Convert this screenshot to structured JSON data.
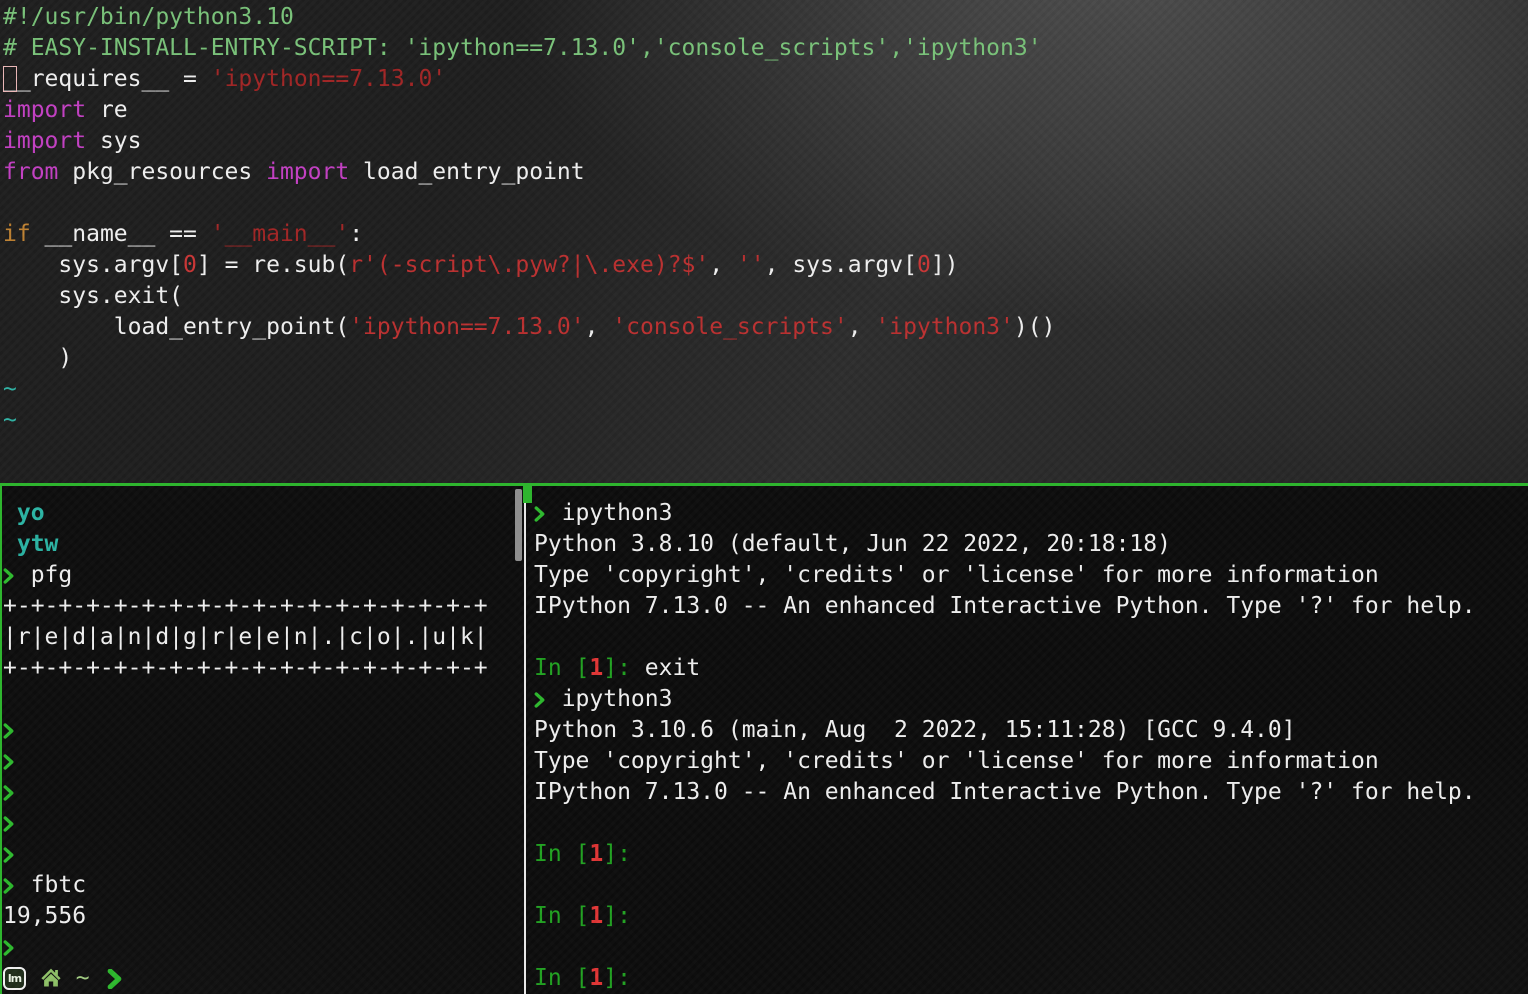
{
  "colors": {
    "accent_green": "#2eb52e",
    "prompt_green": "#2db92d",
    "comment_green": "#7ac47a",
    "keyword_magenta": "#c540c5",
    "conditional_orange": "#c08232",
    "string_red": "#bc3030",
    "string_dim_red": "#a22525",
    "number_red": "#cb3636",
    "ipython_in_green": "#21a321",
    "ipython_number_red": "#e23535",
    "teal": "#2fb3a5",
    "status_green": "#a4cf84",
    "foreground": "#f1f1f1",
    "divider_white": "#e8e8e8"
  },
  "editor_pane": {
    "lines": [
      [
        {
          "t": "#!/usr/bin/python3.10",
          "s": "c"
        }
      ],
      [
        {
          "t": "# EASY-INSTALL-ENTRY-SCRIPT: 'ipython==7.13.0','console_scripts','ipython3'",
          "s": "c"
        }
      ],
      [
        {
          "t": "_",
          "s": "cur"
        },
        {
          "t": "_requires__ = ",
          "s": "w"
        },
        {
          "t": "'ipython==7.13.0'",
          "s": "strd"
        }
      ],
      [
        {
          "t": "import",
          "s": "kw"
        },
        {
          "t": " re",
          "s": "w"
        }
      ],
      [
        {
          "t": "import",
          "s": "kw"
        },
        {
          "t": " sys",
          "s": "w"
        }
      ],
      [
        {
          "t": "from",
          "s": "kw"
        },
        {
          "t": " pkg_resources ",
          "s": "w"
        },
        {
          "t": "import",
          "s": "kw"
        },
        {
          "t": " load_entry_point",
          "s": "w"
        }
      ],
      [],
      [
        {
          "t": "if",
          "s": "cond"
        },
        {
          "t": " __name__ == ",
          "s": "w"
        },
        {
          "t": "'__main__'",
          "s": "strd"
        },
        {
          "t": ":",
          "s": "w"
        }
      ],
      [
        {
          "t": "    sys.argv[",
          "s": "w"
        },
        {
          "t": "0",
          "s": "num"
        },
        {
          "t": "] = re.sub(",
          "s": "w"
        },
        {
          "t": "r'(-script\\.pyw?|\\.exe)?$'",
          "s": "str"
        },
        {
          "t": ", ",
          "s": "w"
        },
        {
          "t": "''",
          "s": "str"
        },
        {
          "t": ", sys.argv[",
          "s": "w"
        },
        {
          "t": "0",
          "s": "num"
        },
        {
          "t": "])",
          "s": "w"
        }
      ],
      [
        {
          "t": "    sys.exit(",
          "s": "w"
        }
      ],
      [
        {
          "t": "        load_entry_point(",
          "s": "w"
        },
        {
          "t": "'ipython==7.13.0'",
          "s": "str"
        },
        {
          "t": ", ",
          "s": "w"
        },
        {
          "t": "'console_scripts'",
          "s": "str"
        },
        {
          "t": ", ",
          "s": "w"
        },
        {
          "t": "'ipython3'",
          "s": "str"
        },
        {
          "t": ")()",
          "s": "w"
        }
      ],
      [
        {
          "t": "    )",
          "s": "w"
        }
      ],
      [
        {
          "t": "~",
          "s": "tilde"
        }
      ],
      [
        {
          "t": "~",
          "s": "tilde"
        }
      ]
    ]
  },
  "left_pane": {
    "lines": [
      [
        {
          "t": " yo",
          "s": "tealb"
        }
      ],
      [
        {
          "t": " ytw",
          "s": "tealb"
        }
      ],
      [
        {
          "i": "arrow"
        },
        {
          "t": " pfg",
          "s": "w"
        }
      ],
      [
        {
          "t": "+-+-+-+-+-+-+-+-+-+-+-+-+-+-+-+-+-+",
          "s": "w"
        }
      ],
      [
        {
          "t": "|r|e|d|a|n|d|g|r|e|e|n|.|c|o|.|u|k|",
          "s": "w"
        }
      ],
      [
        {
          "t": "+-+-+-+-+-+-+-+-+-+-+-+-+-+-+-+-+-+",
          "s": "w"
        }
      ],
      [],
      [
        {
          "i": "arrow"
        }
      ],
      [
        {
          "i": "arrow"
        }
      ],
      [
        {
          "i": "arrow"
        }
      ],
      [
        {
          "i": "arrow"
        }
      ],
      [
        {
          "i": "arrow"
        }
      ],
      [
        {
          "i": "arrow"
        },
        {
          "t": " fbtc",
          "s": "w"
        }
      ],
      [
        {
          "t": "19,556",
          "s": "w"
        }
      ],
      [
        {
          "i": "arrow"
        }
      ],
      [
        {
          "i": "mint"
        },
        {
          "t": " ",
          "s": "w"
        },
        {
          "i": "home"
        },
        {
          "t": " ",
          "s": "w"
        },
        {
          "t": "~",
          "s": "lg"
        },
        {
          "t": " ",
          "s": "w"
        },
        {
          "i": "arrowbig"
        }
      ]
    ]
  },
  "right_pane": {
    "lines": [
      [
        {
          "i": "arrow"
        },
        {
          "t": " ipython3",
          "s": "w"
        }
      ],
      [
        {
          "t": "Python 3.8.10 (default, Jun 22 2022, 20:18:18)",
          "s": "w"
        }
      ],
      [
        {
          "t": "Type 'copyright', 'credits' or 'license' for more information",
          "s": "w"
        }
      ],
      [
        {
          "t": "IPython 7.13.0 -- An enhanced Interactive Python. Type '?' for help.",
          "s": "w"
        }
      ],
      [],
      [
        {
          "t": "In [",
          "s": "ing"
        },
        {
          "t": "1",
          "s": "inr"
        },
        {
          "t": "]: ",
          "s": "ing"
        },
        {
          "t": "exit",
          "s": "w"
        }
      ],
      [
        {
          "i": "arrow"
        },
        {
          "t": " ipython3",
          "s": "w"
        }
      ],
      [
        {
          "t": "Python 3.10.6 (main, Aug  2 2022, 15:11:28) [GCC 9.4.0]",
          "s": "w"
        }
      ],
      [
        {
          "t": "Type 'copyright', 'credits' or 'license' for more information",
          "s": "w"
        }
      ],
      [
        {
          "t": "IPython 7.13.0 -- An enhanced Interactive Python. Type '?' for help.",
          "s": "w"
        }
      ],
      [],
      [
        {
          "t": "In [",
          "s": "ing"
        },
        {
          "t": "1",
          "s": "inr"
        },
        {
          "t": "]:",
          "s": "ing"
        }
      ],
      [],
      [
        {
          "t": "In [",
          "s": "ing"
        },
        {
          "t": "1",
          "s": "inr"
        },
        {
          "t": "]:",
          "s": "ing"
        }
      ],
      [],
      [
        {
          "t": "In [",
          "s": "ing"
        },
        {
          "t": "1",
          "s": "inr"
        },
        {
          "t": "]:",
          "s": "ing"
        }
      ]
    ]
  }
}
